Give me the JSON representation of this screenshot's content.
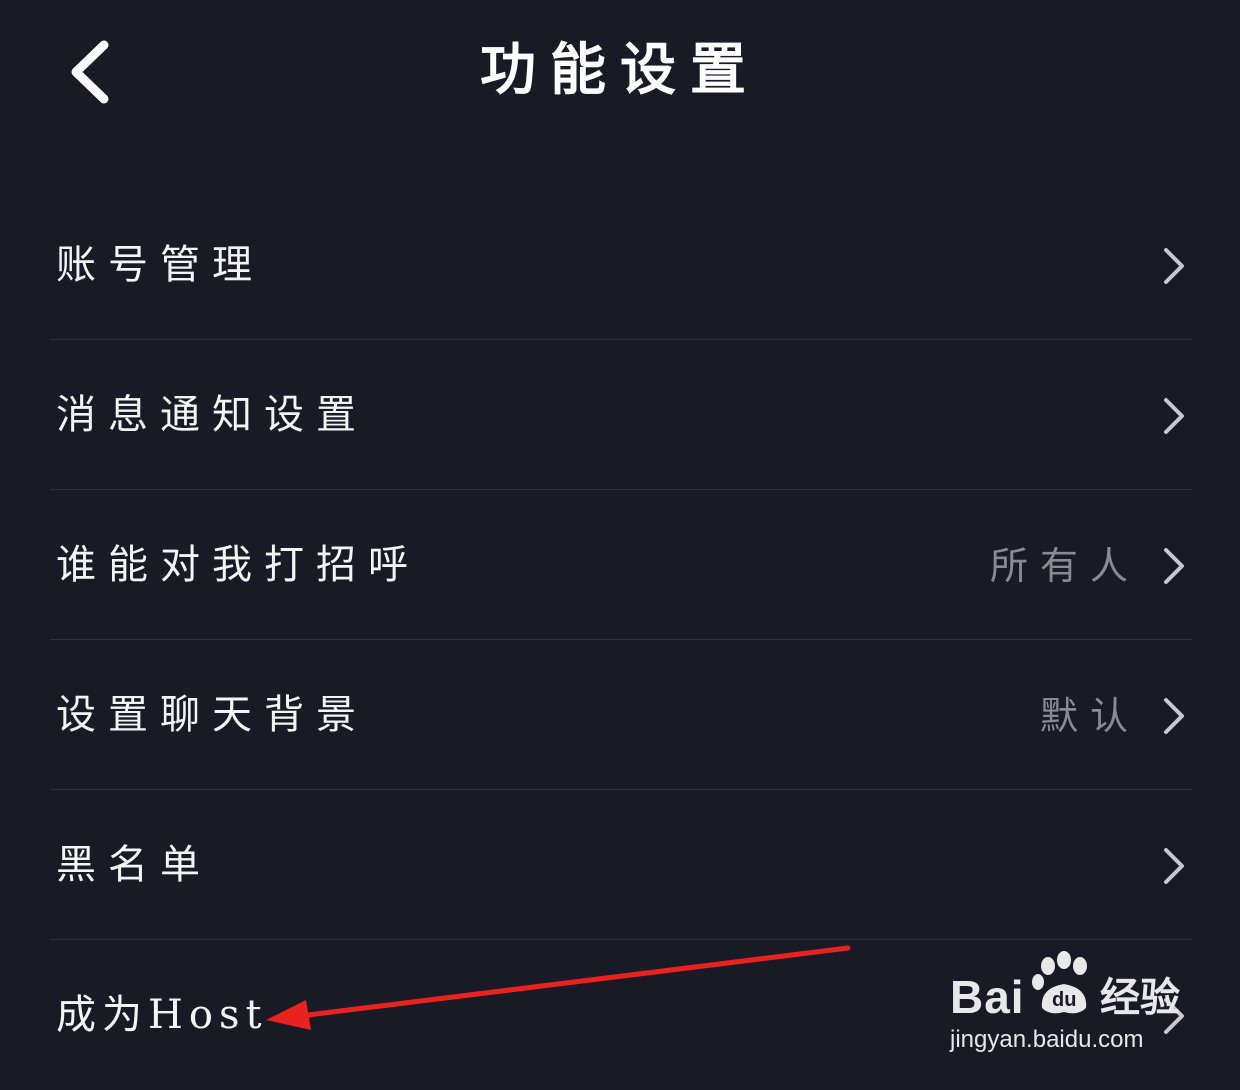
{
  "header": {
    "title": "功能设置",
    "back_icon": "chevron-left-icon"
  },
  "settings": {
    "items": [
      {
        "label": "账号管理",
        "value": ""
      },
      {
        "label": "消息通知设置",
        "value": ""
      },
      {
        "label": "谁能对我打招呼",
        "value": "所有人"
      },
      {
        "label": "设置聊天背景",
        "value": "默认"
      },
      {
        "label": "黑名单",
        "value": ""
      },
      {
        "label": "成为Host",
        "value": ""
      }
    ]
  },
  "annotation": {
    "arrow_color": "#e8231f"
  },
  "watermark": {
    "logo": "Bai",
    "logo_suffix": "经验",
    "url": "jingyan.baidu.com"
  },
  "colors": {
    "background": "#181a26",
    "divider": "#2e303b",
    "secondary_text": "#8a8b91"
  }
}
